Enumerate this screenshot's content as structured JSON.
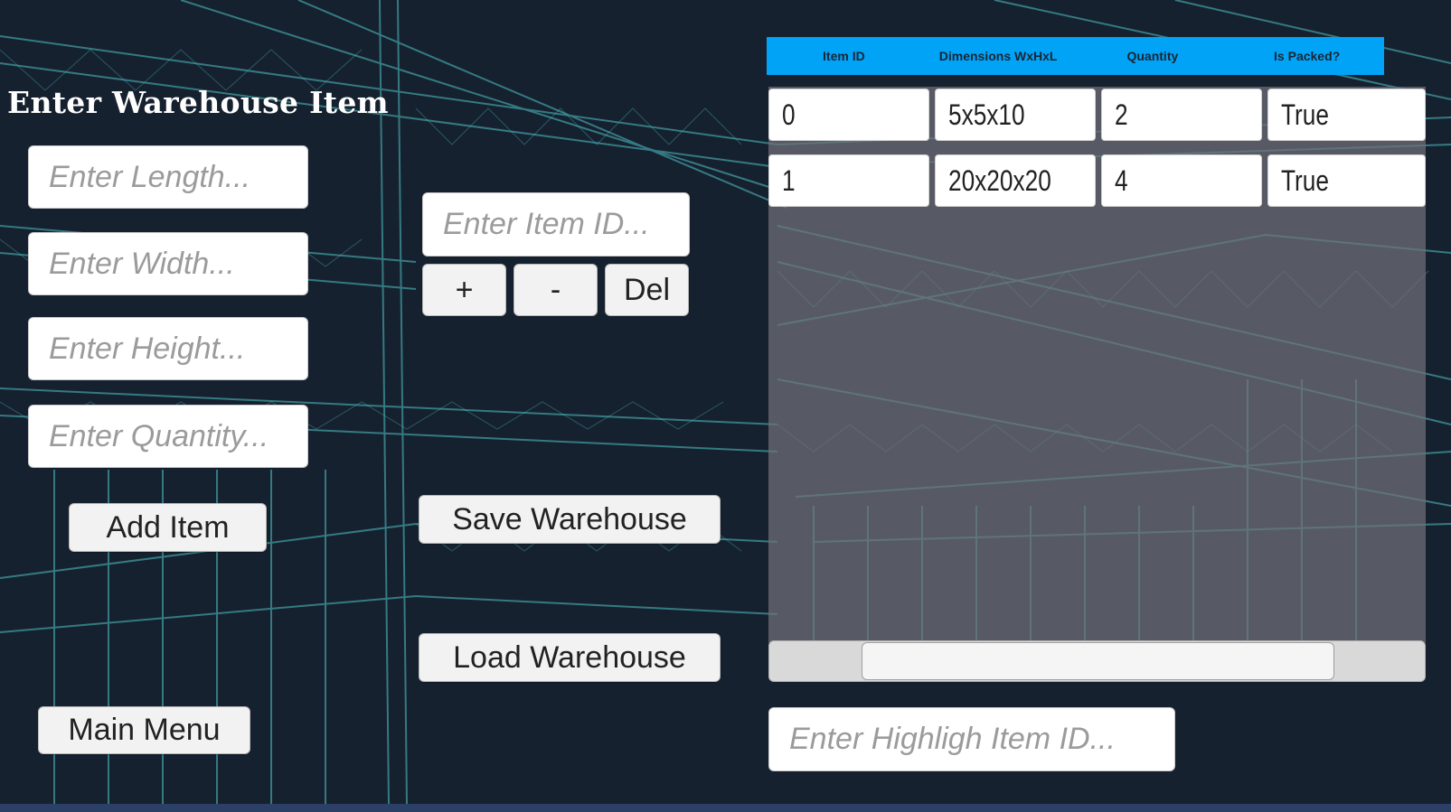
{
  "form": {
    "title": "Enter Warehouse Item",
    "length_placeholder": "Enter Length...",
    "width_placeholder": "Enter Width...",
    "height_placeholder": "Enter Height...",
    "quantity_placeholder": "Enter Quantity...",
    "add_item_label": "Add Item",
    "main_menu_label": "Main Menu"
  },
  "item_controls": {
    "item_id_placeholder": "Enter Item ID...",
    "plus_label": "+",
    "minus_label": "-",
    "delete_label": "Del",
    "save_label": "Save Warehouse",
    "load_label": "Load Warehouse"
  },
  "table": {
    "columns": [
      "Item ID",
      "Dimensions WxHxL",
      "Quantity",
      "Is Packed?"
    ],
    "rows": [
      [
        "0",
        "5x5x10",
        "2",
        "True"
      ],
      [
        "1",
        "20x20x20",
        "4",
        "True"
      ]
    ],
    "horizontal_scroll": {
      "thumb_start": 0.14,
      "thumb_end": 0.86
    }
  },
  "highlight": {
    "placeholder": "Enter Highligh Item ID..."
  },
  "colors": {
    "header_bg": "#00a3f6",
    "background": "#16212f",
    "blueprint_lines": "#4fc3c9"
  }
}
